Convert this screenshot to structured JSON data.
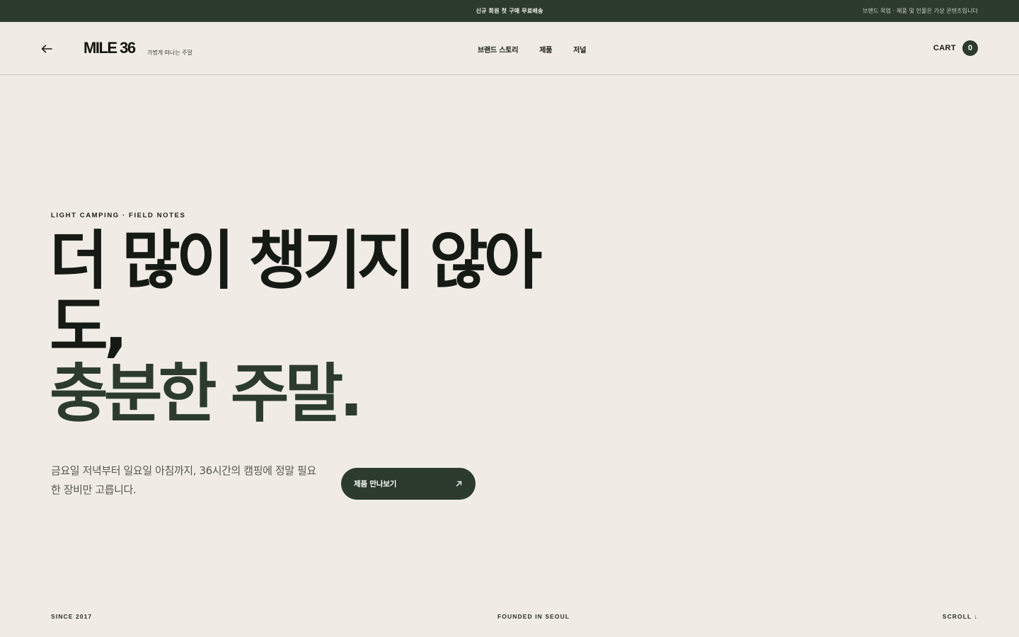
{
  "announcement": {
    "promo": "신규 회원 첫 구매 무료배송",
    "disclaimer": "브랜드 목업 · 제품 및 인물은 가상 콘텐츠입니다"
  },
  "header": {
    "back_icon": "arrow-left-icon",
    "logo": "MILE 36",
    "tagline": "가볍게 떠나는 주말",
    "menu": [
      {
        "label": "브랜드 스토리"
      },
      {
        "label": "제품"
      },
      {
        "label": "저널"
      }
    ],
    "cart_label": "CART",
    "cart_count": "0"
  },
  "hero": {
    "eyebrow": "LIGHT CAMPING · FIELD NOTES",
    "headline_line1": "더 많이 챙기지 않아도,",
    "headline_line2": "충분한 주말.",
    "lede": "금요일 저녁부터 일요일 아침까지, 36시간의 캠핑에 정말 필요한 장비만 고릅니다.",
    "cta_label": "제품 만나보기",
    "cta_icon": "arrow-up-right-icon"
  },
  "footer": {
    "since": "SINCE 2017",
    "founded": "FOUNDED IN SEOUL",
    "scroll": "SCROLL ↓"
  },
  "colors": {
    "accent": "#2c3b2e",
    "background": "#f0ece5",
    "text": "#161a14"
  }
}
